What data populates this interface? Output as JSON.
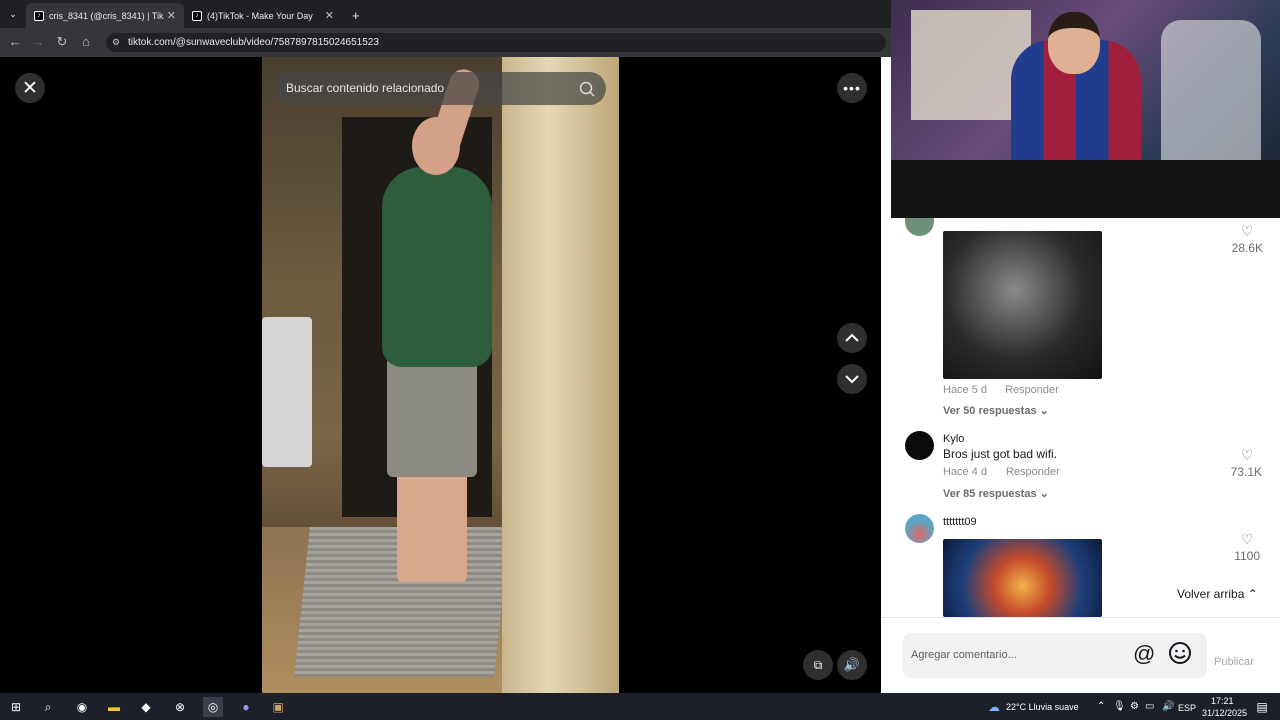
{
  "browser": {
    "tabs": [
      {
        "title": "cris_8341 (@cris_8341) | Tik",
        "active": true
      },
      {
        "title": "(4)TikTok - Make Your Day",
        "active": false
      }
    ],
    "new_tab": "+",
    "url": "tiktok.com/@sunwaveclub/video/7587897815024651523"
  },
  "video": {
    "search_placeholder": "Buscar contenido relacionado",
    "close_glyph": "✕",
    "more_glyph": "•••",
    "pip_glyph": "⧉",
    "volume_glyph": "🔊"
  },
  "comments": [
    {
      "name": "",
      "text": "",
      "time": "Hace 5 d",
      "reply": "Responder",
      "more": "Ver 50 respuestas ⌄",
      "likes": "28.6K",
      "image": "grayscale-portrait"
    },
    {
      "name": "Kylo",
      "text": "Bros just got bad wifi.",
      "time": "Hace 4 d",
      "reply": "Responder",
      "more": "Ver 85 respuestas ⌄",
      "likes": "73.1K"
    },
    {
      "name": "ttttttt09",
      "text": "",
      "likes": "1100",
      "image": "cosmic-portrait"
    }
  ],
  "panel": {
    "back_to_top": "Volver arriba ⌃",
    "comment_placeholder": "Agregar comentario...",
    "at_glyph": "@",
    "publish": "Publicar"
  },
  "taskbar": {
    "weather": "22°C  Lluvia suave",
    "lang": "ESP",
    "time": "17:21",
    "date": "31/12/2025"
  },
  "colors": {
    "panel_bg": "#ffffff",
    "stage_bg": "#000000",
    "taskbar_bg": "#1c2028"
  }
}
